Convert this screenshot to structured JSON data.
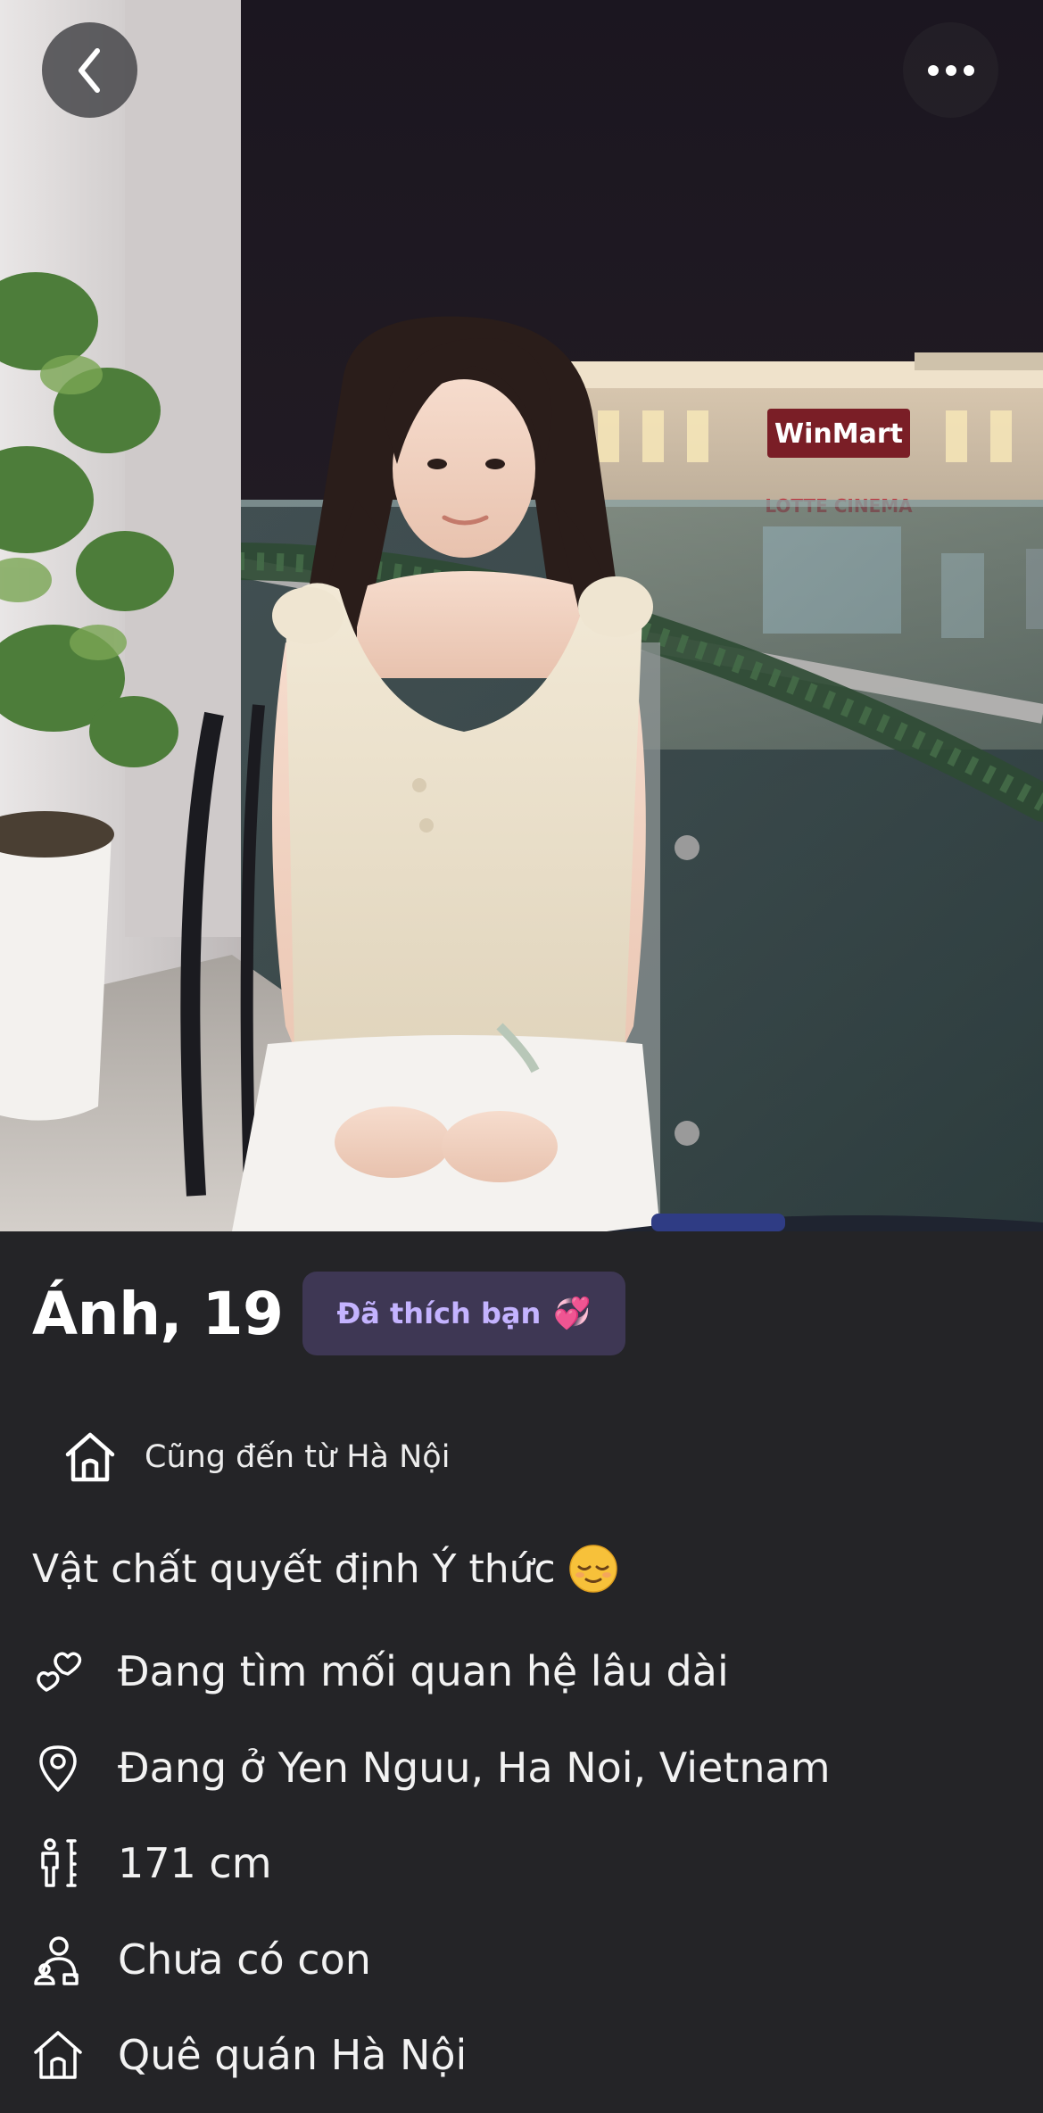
{
  "profile": {
    "name_age": "Ánh, 19",
    "liked_badge": "Đã thích bạn",
    "liked_emoji": "💞",
    "hometown_chip": "Cũng đến từ Hà Nội",
    "bio": "Vật chất quyết định Ý thức",
    "bio_emoji": "relieved-face-emoji"
  },
  "details": [
    {
      "icon": "hearts-icon",
      "text": "Đang tìm mối quan hệ lâu dài"
    },
    {
      "icon": "location-pin-icon",
      "text": "Đang ở Yen Nguu, Ha Noi, Vietnam"
    },
    {
      "icon": "height-icon",
      "text": "171 cm"
    },
    {
      "icon": "person-child-icon",
      "text": "Chưa có con"
    },
    {
      "icon": "house-icon",
      "text": "Quê quán Hà Nội"
    }
  ],
  "photo_signs": {
    "store": "WinMart",
    "cinema": "LOTTE CINEMA"
  },
  "colors": {
    "background": "#242427",
    "badge_bg": "#3e3754",
    "badge_text": "#c4b3ff",
    "text": "#f2f2f2"
  }
}
